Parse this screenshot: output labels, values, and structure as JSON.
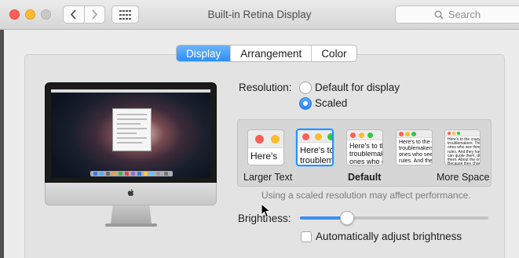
{
  "window": {
    "title": "Built-in Retina Display",
    "search_placeholder": "Search",
    "icons": [
      "close-button",
      "minimize-button",
      "zoom-button",
      "chevron-left-icon",
      "chevron-right-icon",
      "grid-icon",
      "search-icon"
    ]
  },
  "tabs": [
    {
      "label": "Display",
      "active": true
    },
    {
      "label": "Arrangement",
      "active": false
    },
    {
      "label": "Color",
      "active": false
    }
  ],
  "resolution": {
    "label": "Resolution:",
    "options": [
      {
        "label": "Default for display",
        "selected": false
      },
      {
        "label": "Scaled",
        "selected": true
      }
    ]
  },
  "scaling": {
    "selected_index": 1,
    "thumbnails": [
      {
        "text": "Here's"
      },
      {
        "text": "Here's to\ntroublem"
      },
      {
        "text": "Here's to th\ntroublemak\nones who c"
      },
      {
        "text": "Here's to the c\ntroublemakers.\nones who see t\nrules. And they"
      },
      {
        "text": "Here's to the crazy ones\ntroublemakers. The rou\nones who see things di\nrules. And they have no\ncan quote them, disagr\nthem. About the only thi\nBecause they change th"
      }
    ],
    "captions": {
      "left": "Larger Text",
      "middle": "Default",
      "right": "More Space"
    },
    "note": "Using a scaled resolution may affect performance."
  },
  "brightness": {
    "label": "Brightness:",
    "level": 0.25,
    "auto_label": "Automatically adjust brightness",
    "auto_checked": false
  },
  "colors": {
    "accent": "#2c8ff8",
    "close": "#fc5f57",
    "minimize": "#fdbc2e"
  }
}
